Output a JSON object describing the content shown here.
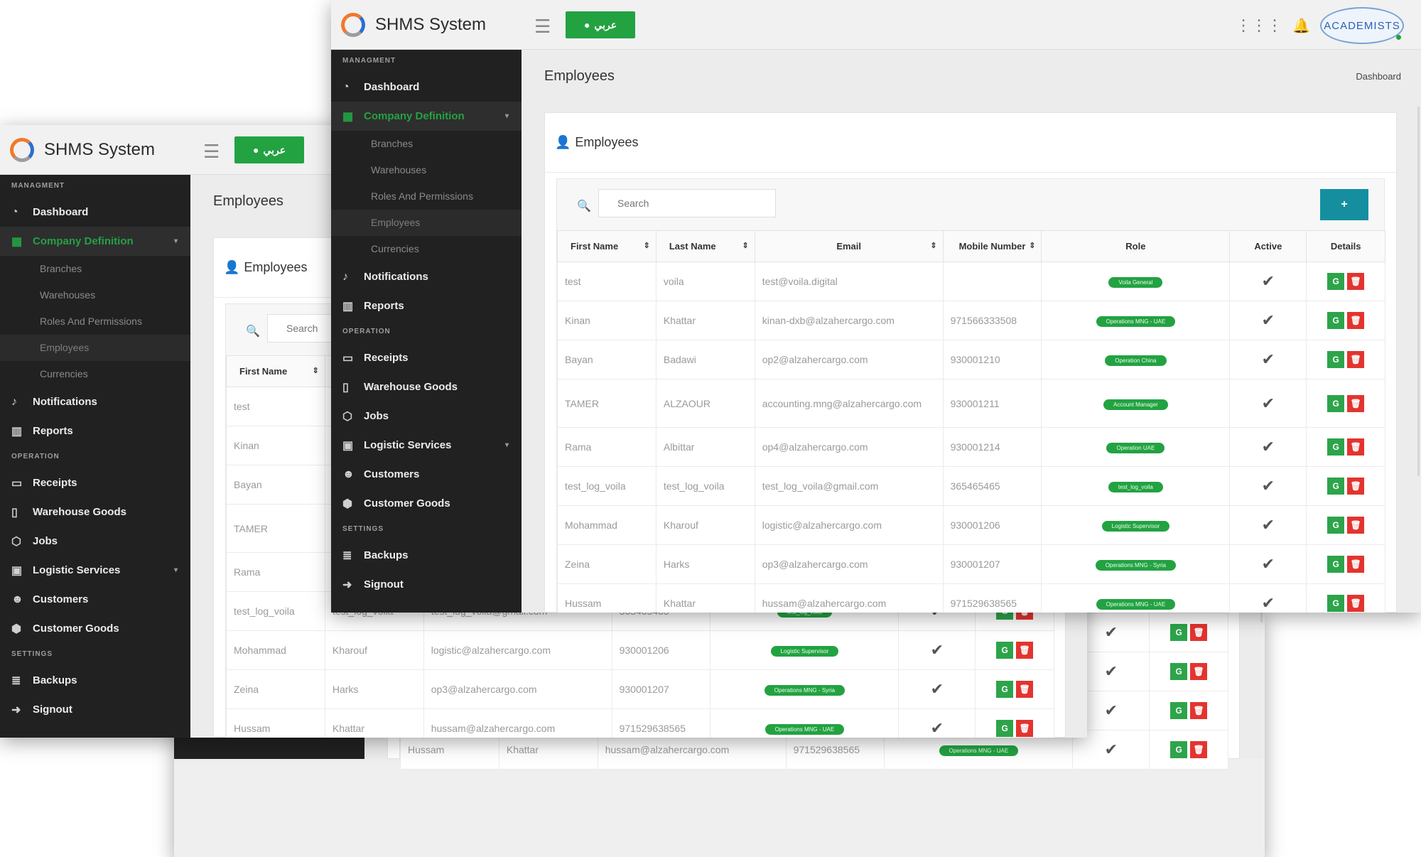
{
  "app": {
    "title": "SHMS System",
    "lang_button": "عربي",
    "logo_text": "ACADEMISTS"
  },
  "sidebar": {
    "sections": {
      "management": "MANAGMENT",
      "operation": "OPERATION",
      "settings": "SETTINGS"
    },
    "management_items": [
      {
        "label": "Dashboard",
        "icon": "dashboard-icon"
      },
      {
        "label": "Company Definition",
        "icon": "building-icon"
      }
    ],
    "sub_items": [
      "Branches",
      "Warehouses",
      "Roles And Permissions",
      "Employees",
      "Currencies"
    ],
    "more_items": [
      {
        "label": "Notifications",
        "icon": "bell-icon"
      },
      {
        "label": "Reports",
        "icon": "chart-icon"
      }
    ],
    "operation_items": [
      {
        "label": "Receipts",
        "icon": "receipt-icon"
      },
      {
        "label": "Warehouse Goods",
        "icon": "phone-icon"
      },
      {
        "label": "Jobs",
        "icon": "cube-icon"
      },
      {
        "label": "Logistic Services",
        "icon": "bag-icon"
      },
      {
        "label": "Customers",
        "icon": "users-icon"
      },
      {
        "label": "Customer Goods",
        "icon": "box-icon"
      }
    ],
    "settings_items": [
      {
        "label": "Backups",
        "icon": "database-icon"
      },
      {
        "label": "Signout",
        "icon": "signout-icon"
      }
    ]
  },
  "page": {
    "title": "Employees",
    "breadcrumb": "Dashboard",
    "card_title": "Employees",
    "search_placeholder": "Search",
    "add_label": "+"
  },
  "table": {
    "headers": [
      "First Name",
      "Last Name",
      "Email",
      "Mobile Number",
      "Role",
      "Active",
      "Details"
    ],
    "rows": [
      {
        "first": "test",
        "last": "voila",
        "email": "test@voila.digital",
        "mobile": "",
        "role": "Voila General",
        "tall": false
      },
      {
        "first": "Kinan",
        "last": "Khattar",
        "email": "kinan-dxb@alzahercargo.com",
        "mobile": "971566333508",
        "role": "Operations MNG - UAE",
        "tall": false
      },
      {
        "first": "Bayan",
        "last": "Badawi",
        "email": "op2@alzahercargo.com",
        "mobile": "930001210",
        "role": "Operation China",
        "tall": false
      },
      {
        "first": "TAMER",
        "last": "ALZAOUR",
        "email": "accounting.mng@alzahercargo.com",
        "mobile": "930001211",
        "role": "Account Manager",
        "tall": true
      },
      {
        "first": "Rama",
        "last": "Albittar",
        "email": "op4@alzahercargo.com",
        "mobile": "930001214",
        "role": "Operation UAE",
        "tall": false
      },
      {
        "first": "test_log_voila",
        "last": "test_log_voila",
        "email": "test_log_voila@gmail.com",
        "mobile": "365465465",
        "role": "test_log_voila",
        "tall": false
      },
      {
        "first": "Mohammad",
        "last": "Kharouf",
        "email": "logistic@alzahercargo.com",
        "mobile": "930001206",
        "role": "Logistic Supervisor",
        "tall": false
      },
      {
        "first": "Zeina",
        "last": "Harks",
        "email": "op3@alzahercargo.com",
        "mobile": "930001207",
        "role": "Operations MNG - Syria",
        "tall": false
      },
      {
        "first": "Hussam",
        "last": "Khattar",
        "email": "hussam@alzahercargo.com",
        "mobile": "971529638565",
        "role": "Operations MNG - UAE",
        "tall": false
      }
    ]
  },
  "colors": {
    "accent_green": "#23a242",
    "sidebar_bg": "#212121",
    "add_button": "#158fa0",
    "delete_red": "#e3342f"
  }
}
